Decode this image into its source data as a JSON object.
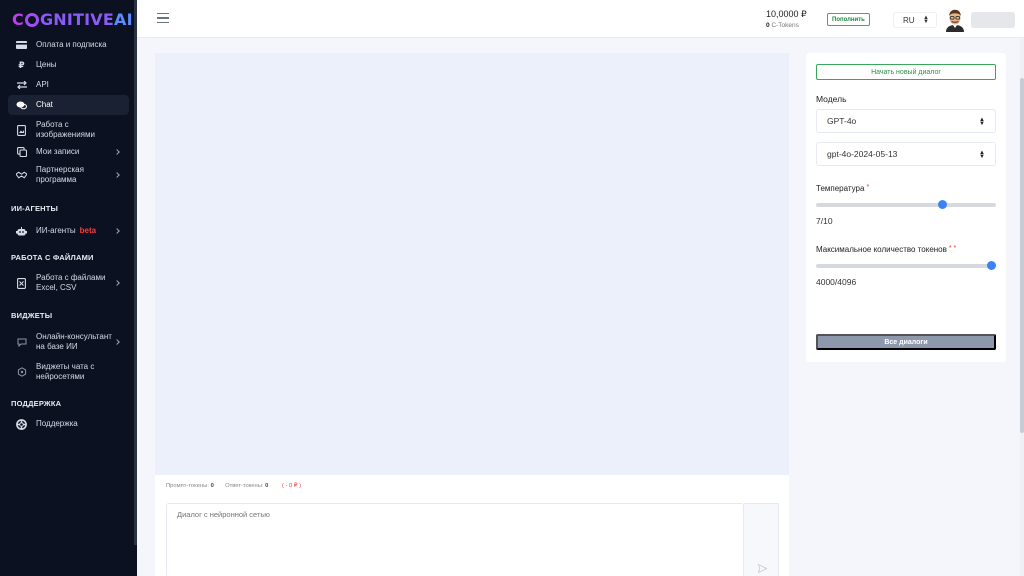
{
  "brand": {
    "logo_part1": "C",
    "logo_part2": "GNITIVE",
    "logo_part3": "AI"
  },
  "sidebar": {
    "items": [
      {
        "label": "Оплата и подписка",
        "icon": "card-icon"
      },
      {
        "label": "Цены",
        "icon": "ruble-icon"
      },
      {
        "label": "API",
        "icon": "arrows-icon"
      },
      {
        "label": "Chat",
        "icon": "chat-icon",
        "active": true
      },
      {
        "label": "Работа с изображениями",
        "icon": "image-doc-icon"
      },
      {
        "label": "Мои записи",
        "icon": "copy-icon",
        "has_children": true
      },
      {
        "label": "Партнерская программа",
        "icon": "handshake-icon",
        "has_children": true
      }
    ],
    "sections": {
      "agents": "ИИ-АГЕНТЫ",
      "files": "РАБОТА С ФАЙЛАМИ",
      "widgets": "ВИДЖЕТЫ",
      "support": "ПОДДЕРЖКА"
    },
    "agents_item": {
      "label": "ИИ-агенты",
      "badge": "beta"
    },
    "files_item": {
      "label": "Работа с файлами Excel, CSV"
    },
    "widgets_items": [
      {
        "label": "Онлайн-консультант на базе ИИ"
      },
      {
        "label": "Виджеты чата с нейросетями"
      }
    ],
    "support_item": {
      "label": "Поддержка"
    }
  },
  "header": {
    "balance": "10,0000 ₽",
    "tokens_value": "0",
    "tokens_label": "C-Tokens",
    "topup_label": "Пополнить",
    "language": "RU"
  },
  "chat": {
    "prompt_tokens_label": "Промпт-токены:",
    "prompt_tokens_value": "0",
    "answer_tokens_label": "Ответ-токены:",
    "answer_tokens_value": "0",
    "cost": "( - 0 ₽ )",
    "input_placeholder": "Диалог с нейронной сетью"
  },
  "panel": {
    "new_dialog_label": "Начать новый диалог",
    "model_label": "Модель",
    "model_value": "GPT-4o",
    "model_version": "gpt-4o-2024-05-13",
    "temperature_label": "Температура",
    "temperature_required": "*",
    "temperature_value": "7/10",
    "temperature_fraction": 0.7,
    "max_tokens_label": "Максимальное количество токенов",
    "max_tokens_required": "* *",
    "max_tokens_value": "4000/4096",
    "max_tokens_fraction": 0.9766,
    "all_dialogs_label": "Все диалоги"
  },
  "colors": {
    "sidebar_bg": "#0b1120",
    "accent_green": "#36b25a",
    "slider_knob": "#3b82f6",
    "required_star": "#e53935",
    "chat_bg": "#ebf0fa"
  }
}
